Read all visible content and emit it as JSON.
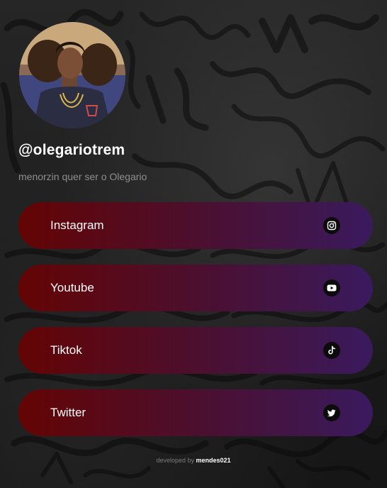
{
  "profile": {
    "username": "@olegariotrem",
    "bio": "menorzin quer ser o Olegario"
  },
  "links": [
    {
      "label": "Instagram",
      "icon": "instagram-icon"
    },
    {
      "label": "Youtube",
      "icon": "youtube-icon"
    },
    {
      "label": "Tiktok",
      "icon": "tiktok-icon"
    },
    {
      "label": "Twitter",
      "icon": "twitter-icon"
    }
  ],
  "footer": {
    "prefix": "developed by",
    "author": "mendes021"
  },
  "colors": {
    "button_gradient_start": "#640404",
    "button_gradient_end": "#3a1a5e",
    "background": "#1b1b1b",
    "text": "#ffffff",
    "muted_text": "#8e8e8e"
  }
}
